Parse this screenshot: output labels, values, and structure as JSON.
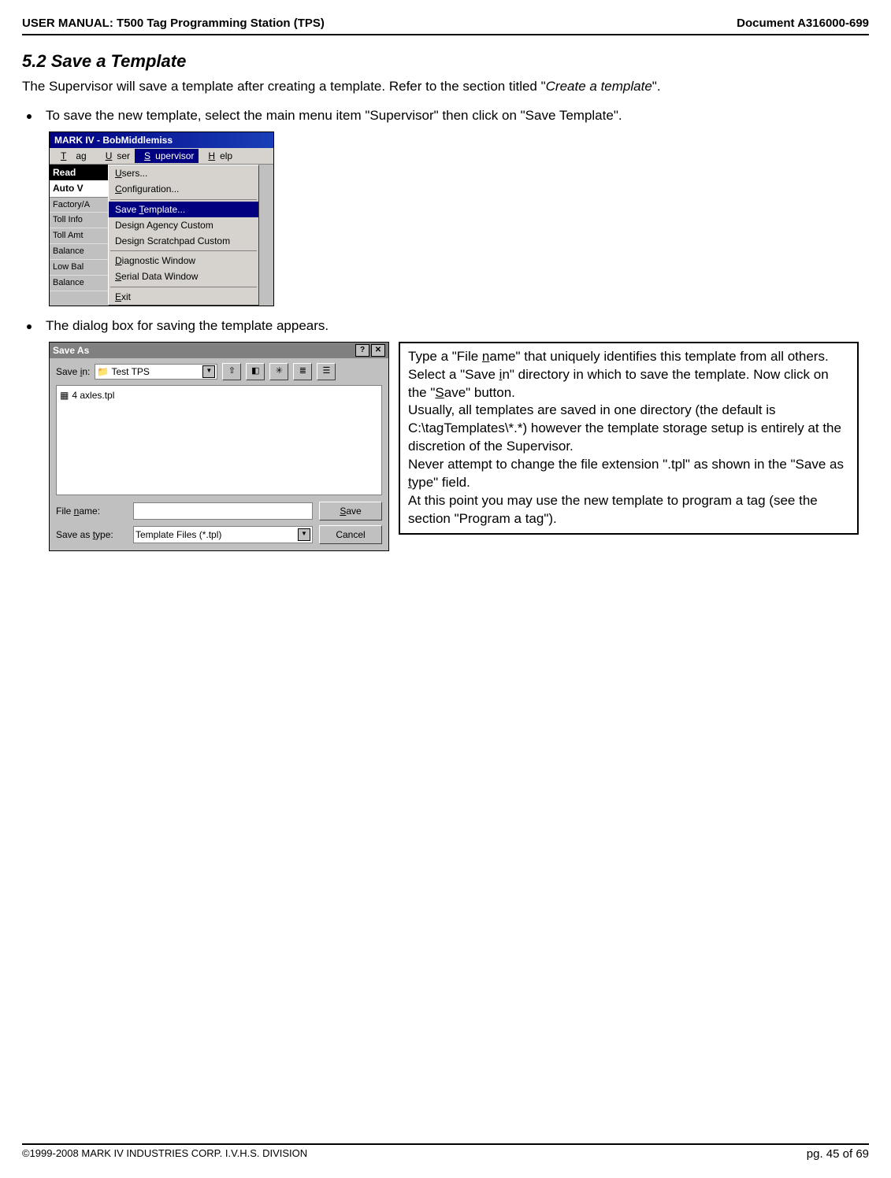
{
  "header": {
    "left": "USER MANUAL: T500 Tag Programming Station (TPS)",
    "right": "Document A316000-699"
  },
  "section": {
    "title": "5.2 Save a Template"
  },
  "intro": {
    "pre": "The Supervisor will save a template after creating a template. Refer to the section titled \"",
    "italic": "Create a template",
    "post": "\"."
  },
  "bullets": {
    "b1": "To save the new template, select the main menu item \"Supervisor\" then click on \"Save Template\".",
    "b2": "The dialog box for saving the template appears."
  },
  "shot1": {
    "title": "MARK IV - BobMiddlemiss",
    "menu": {
      "tag": "Tag",
      "user": "User",
      "supervisor": "Supervisor",
      "help": "Help"
    },
    "left": {
      "read": "Read",
      "auto": "Auto V",
      "factory": "Factory/A",
      "tollInfo": "Toll Info",
      "tollAmt": "Toll Amt",
      "balance": "Balance",
      "lowBal": "Low Bal",
      "balance2": "Balance"
    },
    "dropdown": {
      "users": "Users...",
      "config": "Configuration...",
      "saveTpl": "Save Template...",
      "designAgency": "Design Agency Custom",
      "designScratch": "Design Scratchpad Custom",
      "diag": "Diagnostic Window",
      "serial": "Serial Data Window",
      "exit": "Exit"
    }
  },
  "shot2": {
    "title": "Save As",
    "saveInLabel": "Save in:",
    "saveInValue": "Test TPS",
    "fileItem": "4 axles.tpl",
    "fileNameLabel": "File name:",
    "fileNameValue": "",
    "saveTypeLabel": "Save as type:",
    "saveTypeValue": "Template Files (*.tpl)",
    "saveBtn": "Save",
    "cancelBtn": "Cancel"
  },
  "callout": {
    "p1a": "Type a \"File ",
    "p1u": "n",
    "p1b": "ame\" that uniquely identifies this template from all others. Select a \"Save ",
    "p1u2": "i",
    "p1c": "n\" directory in which to save the template. Now click on the \"",
    "p1u3": "S",
    "p1d": "ave\" button.",
    "p2": "Usually, all templates are saved in one directory (the default is C:\\tagTemplates\\*.*) however the template storage setup is entirely at the discretion of the Supervisor.",
    "p3a": "Never attempt to change the file extension \".tpl\" as shown in the \"Save as ",
    "p3u": "t",
    "p3b": "ype\" field.",
    "p4": "At this point you may use the new template to program a tag (see the section \"Program a tag\")."
  },
  "footer": {
    "copyright": "©1999-2008 MARK IV INDUSTRIES CORP. I.V.H.S. DIVISION",
    "page": "pg. 45 of 69"
  }
}
